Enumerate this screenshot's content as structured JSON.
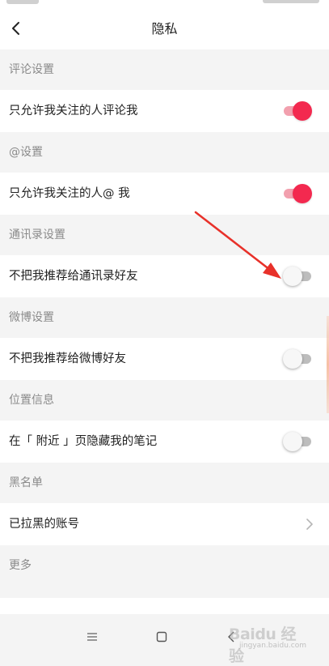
{
  "header": {
    "title": "隐私",
    "back_icon": "chevron-left-icon"
  },
  "sections": [
    {
      "id": "comment",
      "header": "评论设置",
      "row": {
        "label": "只允许我关注的人评论我",
        "control": "toggle",
        "on": true
      }
    },
    {
      "id": "mention",
      "header": "@设置",
      "row": {
        "label": "只允许我关注的人@ 我",
        "control": "toggle",
        "on": true
      }
    },
    {
      "id": "contacts",
      "header": "通讯录设置",
      "row": {
        "label": "不把我推荐给通讯录好友",
        "control": "toggle",
        "on": false
      }
    },
    {
      "id": "weibo",
      "header": "微博设置",
      "row": {
        "label": "不把我推荐给微博好友",
        "control": "toggle",
        "on": false
      }
    },
    {
      "id": "location",
      "header": "位置信息",
      "row": {
        "label": "在「 附近 」页隐藏我的笔记",
        "control": "toggle",
        "on": false
      }
    },
    {
      "id": "blacklist",
      "header": "黑名单",
      "row": {
        "label": "已拉黑的账号",
        "control": "chevron"
      }
    },
    {
      "id": "more",
      "header": "更多"
    }
  ],
  "system_nav": {
    "menu_icon": "menu-icon",
    "home_icon": "square-home-icon",
    "back_icon": "triangle-back-icon"
  },
  "watermark": {
    "text": "Baidu 经验",
    "sub": "jingyan.baidu.com"
  },
  "colors": {
    "toggle_on": "#f3294f",
    "toggle_on_track": "#f2a0ae",
    "toggle_off_track": "#bdbdbd",
    "arrow": "#e8312a",
    "section_text": "#8a8a8a",
    "background": "#f4f4f4"
  }
}
